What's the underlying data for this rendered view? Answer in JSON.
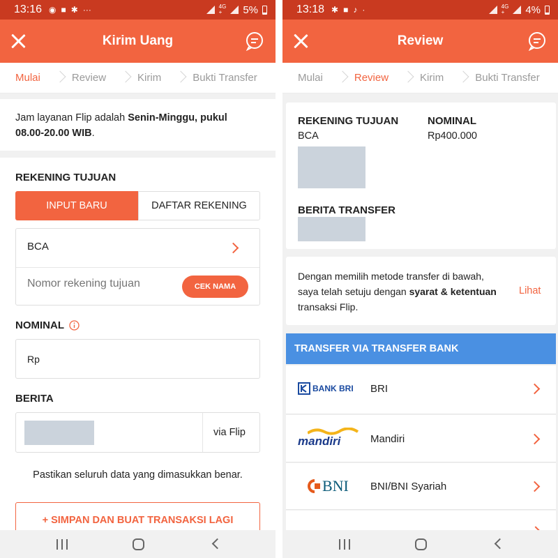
{
  "left": {
    "status": {
      "time": "13:16",
      "battery": "5%"
    },
    "appbar": {
      "title": "Kirim Uang"
    },
    "steps": [
      "Mulai",
      "Review",
      "Kirim",
      "Bukti Transfer"
    ],
    "notice": {
      "text_normal": "Jam layanan Flip adalah ",
      "text_bold_1": "Senin-Minggu, pukul",
      "text_bold_2": "08.00-20.00 WIB",
      "text_end": "."
    },
    "rekening": {
      "heading": "REKENING TUJUAN",
      "tab_new": "INPUT BARU",
      "tab_list": "DAFTAR REKENING",
      "bank_value": "BCA",
      "account_placeholder": "Nomor rekening tujuan",
      "cek_button": "CEK NAMA"
    },
    "nominal": {
      "heading": "NOMINAL",
      "prefix": "Rp"
    },
    "berita": {
      "heading": "BERITA",
      "suffix": "via Flip"
    },
    "confirm_text": "Pastikan seluruh data yang dimasukkan benar.",
    "save_button": "+ SIMPAN DAN BUAT TRANSAKSI LAGI"
  },
  "right": {
    "status": {
      "time": "13:18",
      "battery": "4%"
    },
    "appbar": {
      "title": "Review"
    },
    "steps": [
      "Mulai",
      "Review",
      "Kirim",
      "Bukti Transfer"
    ],
    "summary": {
      "rekening_heading": "REKENING TUJUAN",
      "bank": "BCA",
      "nominal_heading": "NOMINAL",
      "nominal_value": "Rp400.000",
      "berita_heading": "BERITA TRANSFER"
    },
    "terms": {
      "line1": "Dengan memilih metode transfer di bawah,",
      "line2_normal": "saya telah setuju dengan ",
      "line2_bold": "syarat & ketentuan",
      "line3": "transaksi Flip.",
      "link": "Lihat"
    },
    "transfer_header": "TRANSFER VIA TRANSFER BANK",
    "banks": [
      {
        "logo_text": "BANK BRI",
        "name": "BRI"
      },
      {
        "logo_text": "mandiri",
        "name": "Mandiri"
      },
      {
        "logo_text": "BNI",
        "name": "BNI/BNI Syariah"
      }
    ]
  },
  "colors": {
    "accent": "#f26440",
    "status_bar": "#c93a20",
    "bank_header": "#4a90e2"
  },
  "icons": [
    "close-icon",
    "chat-icon",
    "chevron-right-icon",
    "info-icon",
    "whatsapp-icon",
    "signal-icon",
    "battery-icon"
  ]
}
